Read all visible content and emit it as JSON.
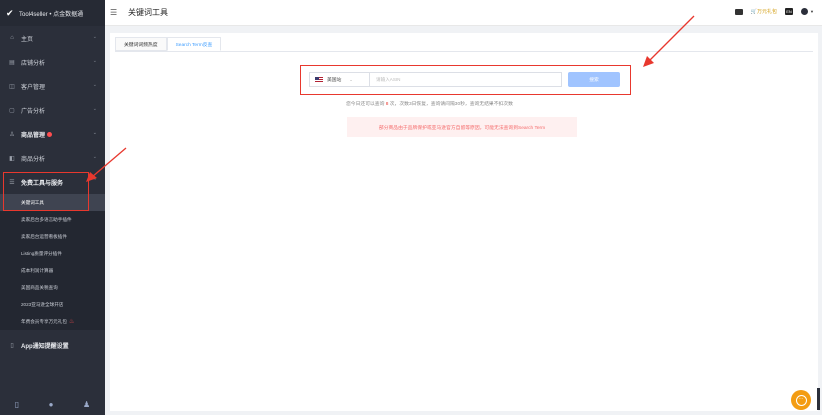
{
  "brand": {
    "name": "Tool4seller • 点金数据通"
  },
  "sidebar": {
    "items": [
      {
        "label": "主页",
        "icon": "home-icon"
      },
      {
        "label": "店铺分析",
        "icon": "store-icon"
      },
      {
        "label": "客户管理",
        "icon": "customer-icon"
      },
      {
        "label": "广告分析",
        "icon": "ad-icon"
      },
      {
        "label": "商品管理",
        "icon": "product-icon"
      },
      {
        "label": "商品分析",
        "icon": "chart-icon"
      },
      {
        "label": "免费工具与服务",
        "icon": "tools-icon"
      }
    ],
    "sub_items": [
      "关键词工具",
      "卖家后台多语言助手插件",
      "卖家后台运营看板插件",
      "Listing质量评分插件",
      "成本利润计算器",
      "美国商品关税查询",
      "2023亚马逊全球开店",
      "年费会员专享万元礼包"
    ],
    "app_settings": "App通知提醒设置"
  },
  "header": {
    "title": "关键词工具",
    "gift_label": "万元礼包",
    "lang_label": "EN"
  },
  "tabs": [
    "关键词词频热度",
    "Search Term反查"
  ],
  "search": {
    "country": "美国站",
    "placeholder": "请输入ASIN",
    "button": "搜索"
  },
  "quota": {
    "prefix": "您今日还可以查询",
    "count": "8",
    "suffix": "次，次数3日恢复，查询请间隔30秒，查询无结果不扣次数"
  },
  "alert": "部分商品由于品牌保护或亚马逊官方自留等原因，可能无法查询到Search Term",
  "colors": {
    "sidebar_bg": "#2b2f3a",
    "accent": "#409eff",
    "annotation_red": "#e8382e",
    "chat": "#f39c12"
  }
}
